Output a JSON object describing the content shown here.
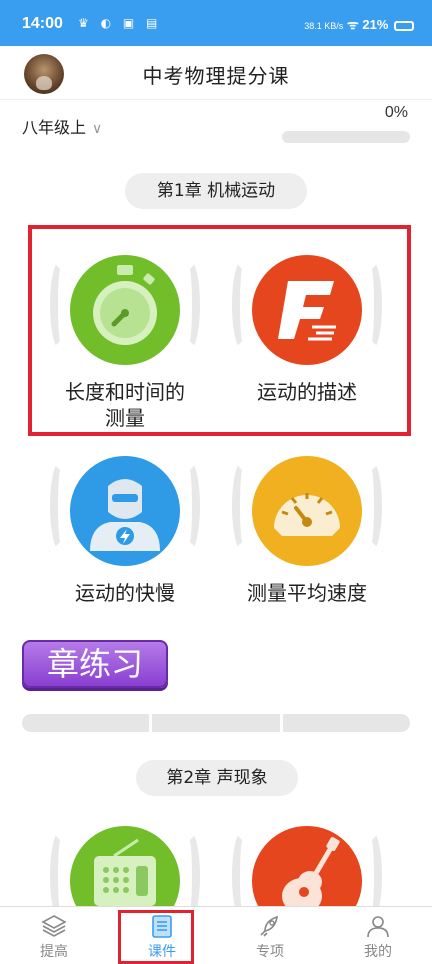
{
  "statusbar": {
    "time": "14:00",
    "net_speed": "38.1 KB/s",
    "battery": "21%",
    "icons": [
      "crown-icon",
      "leaf-icon",
      "calendar-icon",
      "taobao-icon",
      "vibrate-icon",
      "data-icon",
      "wifi-icon",
      "battery-icon"
    ]
  },
  "header": {
    "title": "中考物理提分课"
  },
  "grade": {
    "label": "八年级上",
    "chevron": "chevron-down-icon"
  },
  "progress": {
    "text": "0%",
    "value": 0
  },
  "chapter1": {
    "title": "第1章  机械运动",
    "lessons": [
      {
        "name": "长度和时间的\n测量",
        "line1": "长度和时间的",
        "line2": "测量",
        "icon": "stopwatch-icon",
        "color": "#72be2a"
      },
      {
        "name": "运动的描述",
        "icon": "f-logo-icon",
        "color": "#e6461e"
      },
      {
        "name": "运动的快慢",
        "icon": "flash-hero-icon",
        "color": "#2f9be6"
      },
      {
        "name": "测量平均速度",
        "icon": "speedometer-icon",
        "color": "#f0b020"
      }
    ],
    "practice_label": "章练习",
    "practice_segments": 3
  },
  "chapter2": {
    "title": "第2章  声现象",
    "lessons": [
      {
        "icon": "radio-icon",
        "color": "#72be2a"
      },
      {
        "icon": "guitar-icon",
        "color": "#e6461e"
      }
    ]
  },
  "tabs": [
    {
      "label": "提高",
      "icon": "layers-icon",
      "active": false
    },
    {
      "label": "课件",
      "icon": "document-icon",
      "active": true
    },
    {
      "label": "专项",
      "icon": "rocket-icon",
      "active": false
    },
    {
      "label": "我的",
      "icon": "user-icon",
      "active": false
    }
  ],
  "colors": {
    "accent": "#3a9ef0",
    "highlight": "#e02330",
    "practice": "#8a3fd1"
  }
}
